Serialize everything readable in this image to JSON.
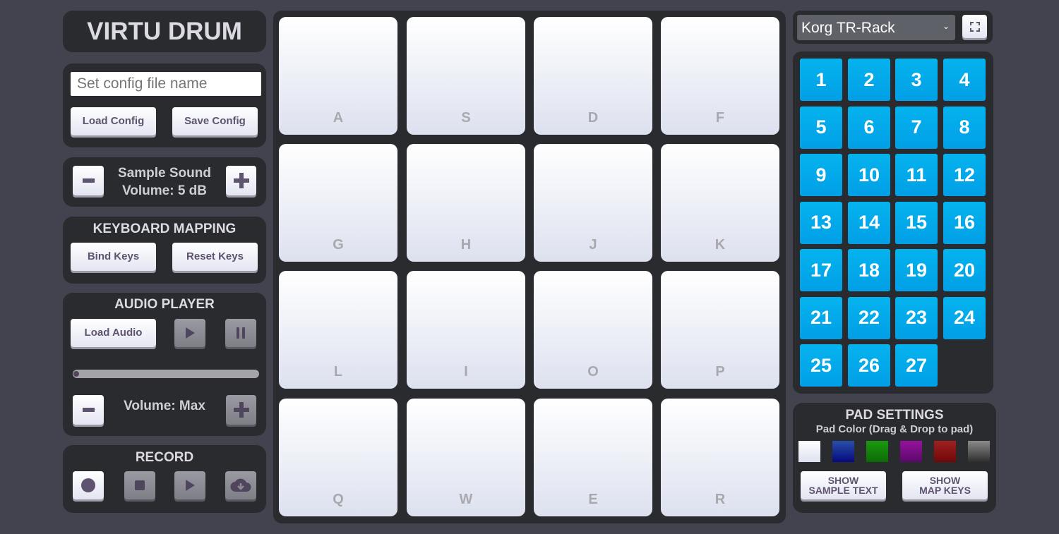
{
  "app": {
    "title": "VIRTU DRUM"
  },
  "config": {
    "input_placeholder": "Set config file name",
    "input_value": "",
    "load_label": "Load Config",
    "save_label": "Save Config"
  },
  "sample_volume": {
    "line1": "Sample Sound",
    "line2": "Volume: 5 dB",
    "decrease_icon": "minus-icon",
    "increase_icon": "plus-icon"
  },
  "keyboard_mapping": {
    "title": "KEYBOARD MAPPING",
    "bind_label": "Bind Keys",
    "reset_label": "Reset Keys"
  },
  "audio_player": {
    "title": "AUDIO PLAYER",
    "load_label": "Load Audio",
    "play_icon": "play-icon",
    "pause_icon": "pause-icon",
    "progress": 0,
    "volume_label": "Volume: Max"
  },
  "record": {
    "title": "RECORD",
    "buttons": [
      "record-icon",
      "stop-icon",
      "play-icon",
      "cloud-download-icon"
    ]
  },
  "pads": [
    "A",
    "S",
    "D",
    "F",
    "G",
    "H",
    "J",
    "K",
    "L",
    "I",
    "O",
    "P",
    "Q",
    "W",
    "E",
    "R"
  ],
  "kit_select": {
    "selected": "Korg TR-Rack"
  },
  "fullscreen": {
    "icon": "fullscreen-icon"
  },
  "kits": [
    "1",
    "2",
    "3",
    "4",
    "5",
    "6",
    "7",
    "8",
    "9",
    "10",
    "11",
    "12",
    "13",
    "14",
    "15",
    "16",
    "17",
    "18",
    "19",
    "20",
    "21",
    "22",
    "23",
    "24",
    "25",
    "26",
    "27"
  ],
  "pad_settings": {
    "title": "PAD SETTINGS",
    "subtitle": "Pad Color (Drag & Drop to pad)",
    "colors": [
      {
        "name": "white",
        "from": "#ffffff",
        "to": "#dde1ef"
      },
      {
        "name": "blue",
        "from": "#2a4fa8",
        "to": "#05097e"
      },
      {
        "name": "green",
        "from": "#1a9a10",
        "to": "#0d6a06"
      },
      {
        "name": "purple",
        "from": "#95119e",
        "to": "#5a0a6a"
      },
      {
        "name": "red",
        "from": "#a02020",
        "to": "#700808"
      },
      {
        "name": "gray",
        "from": "#8a8a8a",
        "to": "#2e2e2e"
      }
    ],
    "show_sample_line1": "SHOW",
    "show_sample_line2": "SAMPLE TEXT",
    "show_keys_line1": "SHOW",
    "show_keys_line2": "MAP KEYS"
  }
}
